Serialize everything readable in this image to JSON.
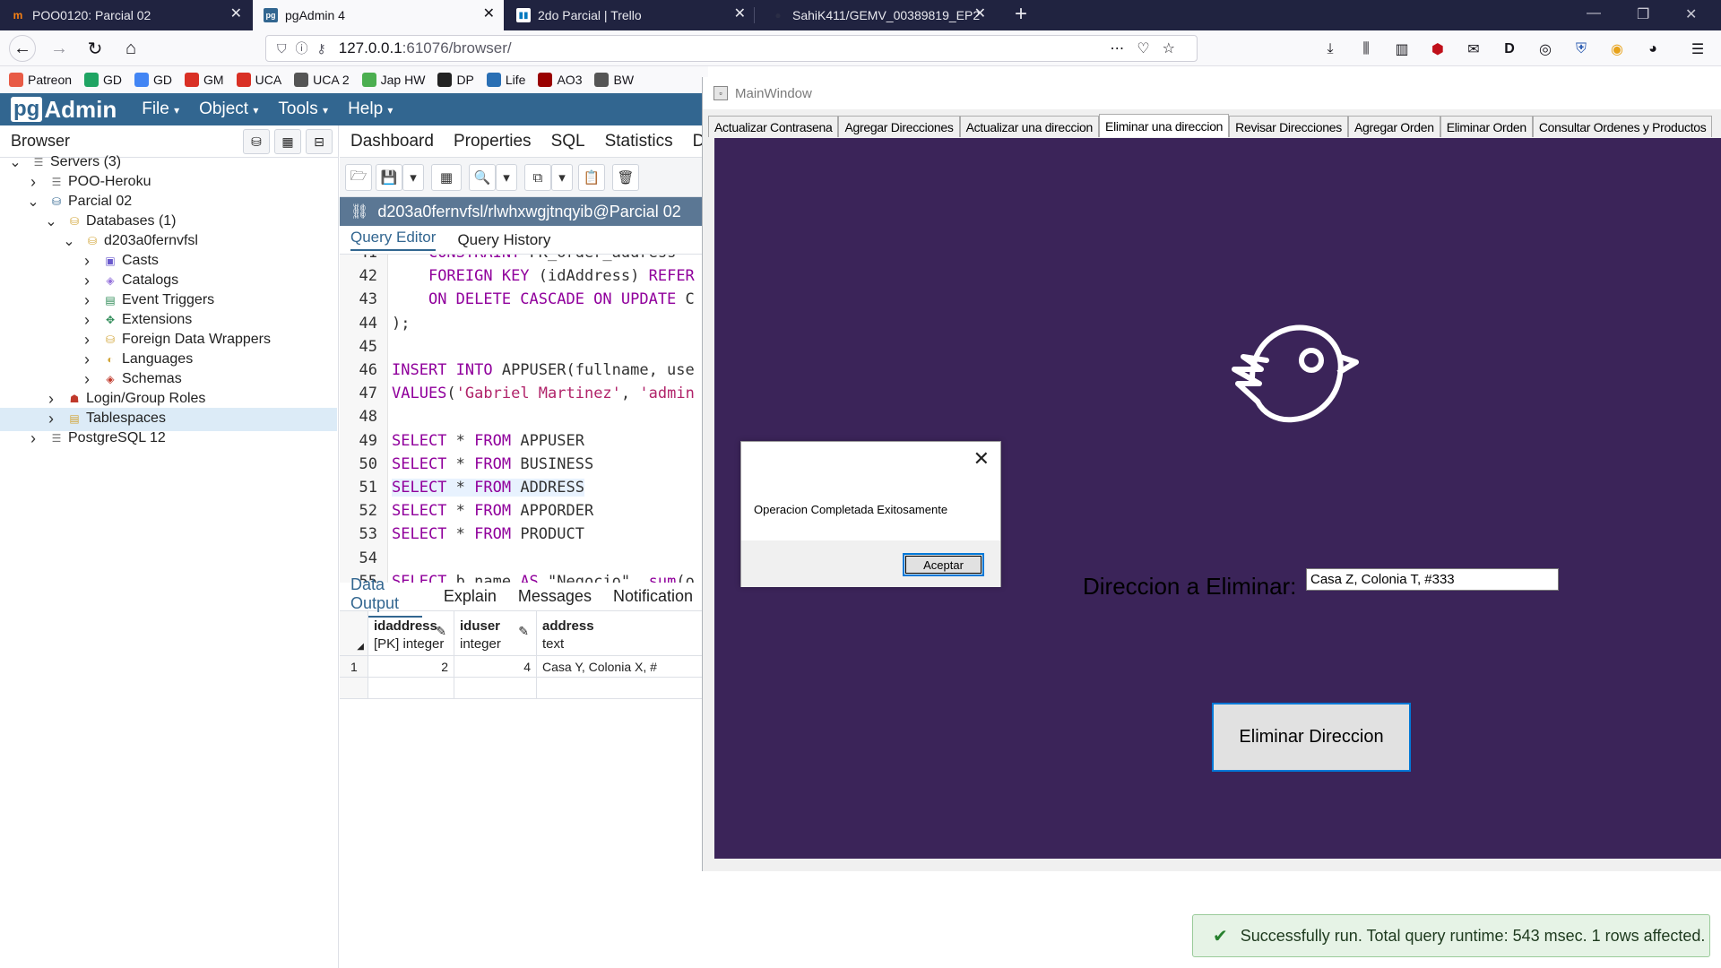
{
  "browser": {
    "tabs": [
      {
        "title": "POO0120: Parcial 02",
        "icon": "moodle-icon"
      },
      {
        "title": "pgAdmin 4",
        "icon": "pgadmin-icon"
      },
      {
        "title": "2do Parcial | Trello",
        "icon": "trello-icon"
      },
      {
        "title": "SahiK411/GEMV_00389819_EP2",
        "icon": "github-icon"
      }
    ],
    "new_tab": "+",
    "window_controls": {
      "minimize": "—",
      "restore": "❐",
      "close": "✕"
    },
    "url_host": "127.0.0.1",
    "url_rest": ":61076/browser/",
    "bookmarks": [
      {
        "label": "Patreon",
        "color": "#e85b46"
      },
      {
        "label": "GD",
        "color": "#1fa463"
      },
      {
        "label": "GD",
        "color": "#4285f4"
      },
      {
        "label": "GM",
        "color": "#d93025"
      },
      {
        "label": "UCA",
        "color": "#d93025"
      },
      {
        "label": "UCA 2",
        "color": "#555555"
      },
      {
        "label": "Jap HW",
        "color": "#4caf50"
      },
      {
        "label": "DP",
        "color": "#222222"
      },
      {
        "label": "Life",
        "color": "#2a6fb4"
      },
      {
        "label": "AO3",
        "color": "#990000"
      },
      {
        "label": "BW",
        "color": "#555555"
      }
    ]
  },
  "pgadmin": {
    "logo_pg": "pg",
    "logo_admin": "Admin",
    "menu": [
      "File",
      "Object",
      "Tools",
      "Help"
    ],
    "browser_title": "Browser",
    "tree": [
      {
        "label": "Servers (3)",
        "twisty": "v",
        "indent": 0,
        "icon": "servers-icon"
      },
      {
        "label": "POO-Heroku",
        "twisty": ">",
        "indent": 1,
        "icon": "server-disconnected-icon"
      },
      {
        "label": "Parcial 02",
        "twisty": "v",
        "indent": 1,
        "icon": "server-connected-icon"
      },
      {
        "label": "Databases (1)",
        "twisty": "v",
        "indent": 2,
        "icon": "databases-icon"
      },
      {
        "label": "d203a0fernvfsl",
        "twisty": "v",
        "indent": 3,
        "icon": "database-icon"
      },
      {
        "label": "Casts",
        "twisty": ">",
        "indent": 4,
        "icon": "casts-icon"
      },
      {
        "label": "Catalogs",
        "twisty": ">",
        "indent": 4,
        "icon": "catalogs-icon"
      },
      {
        "label": "Event Triggers",
        "twisty": ">",
        "indent": 4,
        "icon": "event-triggers-icon"
      },
      {
        "label": "Extensions",
        "twisty": ">",
        "indent": 4,
        "icon": "extensions-icon"
      },
      {
        "label": "Foreign Data Wrappers",
        "twisty": ">",
        "indent": 4,
        "icon": "fdw-icon"
      },
      {
        "label": "Languages",
        "twisty": ">",
        "indent": 4,
        "icon": "languages-icon"
      },
      {
        "label": "Schemas",
        "twisty": ">",
        "indent": 4,
        "icon": "schemas-icon"
      },
      {
        "label": "Login/Group Roles",
        "twisty": ">",
        "indent": 2,
        "icon": "roles-icon"
      },
      {
        "label": "Tablespaces",
        "twisty": ">",
        "indent": 2,
        "icon": "tablespaces-icon"
      },
      {
        "label": "PostgreSQL 12",
        "twisty": ">",
        "indent": 1,
        "icon": "server-disconnected-icon"
      }
    ],
    "main_tabs": [
      "Dashboard",
      "Properties",
      "SQL",
      "Statistics",
      "De"
    ],
    "connection": "d203a0fernvfsl/rlwhxwgjtnqyib@Parcial 02",
    "query_tabs": [
      "Query Editor",
      "Query History"
    ],
    "code_lines": [
      {
        "n": "41",
        "html": "    <span class='kw'>CONSTRAINT</span> FK_order_address"
      },
      {
        "n": "42",
        "html": "    <span class='kw'>FOREIGN KEY</span> (idAddress) <span class='kw'>REFER</span>"
      },
      {
        "n": "43",
        "html": "    <span class='kw'>ON DELETE CASCADE ON UPDATE</span> C"
      },
      {
        "n": "44",
        "html": ");"
      },
      {
        "n": "45",
        "html": ""
      },
      {
        "n": "46",
        "html": "<span class='kw'>INSERT INTO</span> APPUSER(fullname, use"
      },
      {
        "n": "47",
        "html": "<span class='kw'>VALUES</span>(<span class='str'>'Gabriel Martinez'</span>, <span class='str'>'admin</span>"
      },
      {
        "n": "48",
        "html": ""
      },
      {
        "n": "49",
        "html": "<span class='kw'>SELECT</span> * <span class='kw'>FROM</span> APPUSER"
      },
      {
        "n": "50",
        "html": "<span class='kw'>SELECT</span> * <span class='kw'>FROM</span> BUSINESS"
      },
      {
        "n": "51",
        "html": "<span class='kw'>SELECT</span> * <span class='kw'>FROM</span> ADDRESS"
      },
      {
        "n": "52",
        "html": "<span class='kw'>SELECT</span> * <span class='kw'>FROM</span> APPORDER"
      },
      {
        "n": "53",
        "html": "<span class='kw'>SELECT</span> * <span class='kw'>FROM</span> PRODUCT"
      },
      {
        "n": "54",
        "html": ""
      },
      {
        "n": "55",
        "html": "<span class='kw'>SELECT</span> b.name <span class='kw'>AS</span> \"Negocio\", <span class='kw'>sum</span>(o"
      }
    ],
    "highlighted_line": "51",
    "output_tabs": [
      "Data Output",
      "Explain",
      "Messages",
      "Notification"
    ],
    "columns": [
      {
        "name": "idaddress",
        "type": "[PK] integer"
      },
      {
        "name": "iduser",
        "type": "integer"
      },
      {
        "name": "address",
        "type": "text"
      }
    ],
    "rows": [
      {
        "num": "1",
        "idaddress": "2",
        "iduser": "4",
        "address": "Casa Y, Colonia X, #"
      }
    ],
    "toast": "Successfully run. Total query runtime: 543 msec. 1 rows affected."
  },
  "mainwindow": {
    "title": "MainWindow",
    "tabs": [
      "Actualizar Contrasena",
      "Agregar Direcciones",
      "Actualizar una direccion",
      "Eliminar una direccion",
      "Revisar Direcciones",
      "Agregar Orden",
      "Eliminar Orden",
      "Consultar Ordenes y Productos"
    ],
    "active_tab": "Eliminar una direccion",
    "label": "Direccion a Eliminar:",
    "input_value": "Casa Z, Colonia T, #333",
    "button": "Eliminar Direccion",
    "panel_color": "#3b2459"
  },
  "messagebox": {
    "text": "Operacion Completada Exitosamente",
    "ok": "Aceptar",
    "close": "✕"
  }
}
